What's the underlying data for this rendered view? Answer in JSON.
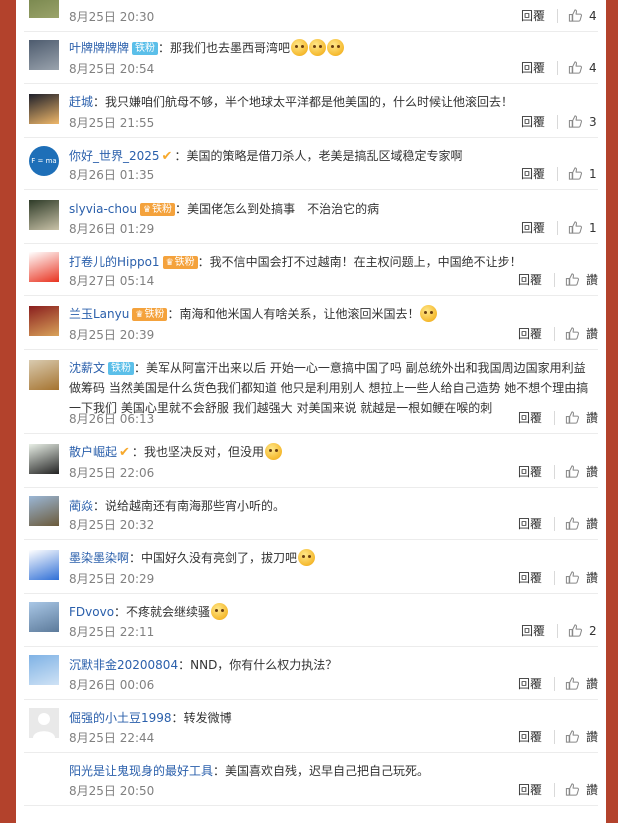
{
  "labels": {
    "reply": "回覆",
    "like_zero": "讚"
  },
  "comments": [
    {
      "user": "",
      "badge": "",
      "badge_type": "",
      "verified": false,
      "text": "",
      "emojis": 0,
      "date": "8月25日 20:30",
      "likes": "4",
      "avatar": [
        "#6f7f46",
        "#9aa36a"
      ]
    },
    {
      "user": "叶牌牌牌牌",
      "badge": "铁粉",
      "badge_type": "blue",
      "verified": false,
      "text": "那我们也去墨西哥湾吧",
      "emojis": 3,
      "date": "8月25日 20:54",
      "likes": "4",
      "avatar": [
        "#4d5b6e",
        "#9aa3ad"
      ]
    },
    {
      "user": "赶城",
      "badge": "",
      "badge_type": "",
      "verified": false,
      "text": "我只嫌咱们航母不够，半个地球太平洋都是他美国的，什么时候让他滚回去！",
      "emojis": 0,
      "date": "8月25日 21:55",
      "likes": "3",
      "avatar": [
        "#1d1f2a",
        "#f0b86a"
      ]
    },
    {
      "user": "你好_世界_2025",
      "badge": "",
      "badge_type": "",
      "verified": true,
      "text": "美国的策略是借刀杀人，老美是搞乱区域稳定专家啊",
      "emojis": 0,
      "date": "8月26日 01:35",
      "likes": "1",
      "avatar": [
        "#1e6fb8",
        "#1e6fb8"
      ],
      "avatar_text": "F = ma"
    },
    {
      "user": "slyvia-chou",
      "badge": "铁粉",
      "badge_type": "gold",
      "verified": false,
      "text": "美国佬怎么到处搞事　不治治它的病",
      "emojis": 0,
      "date": "8月26日 01:29",
      "likes": "1",
      "avatar": [
        "#2e3b28",
        "#c9c2a8"
      ]
    },
    {
      "user": "打卷儿的Hippo1",
      "badge": "铁粉",
      "badge_type": "gold",
      "verified": false,
      "text": "我不信中国会打不过越南！在主权问题上，中国绝不让步！",
      "emojis": 0,
      "date": "8月27日 05:14",
      "likes": "",
      "avatar": [
        "#ffffff",
        "#e8321f"
      ]
    },
    {
      "user": "兰玉Lanyu",
      "badge": "铁粉",
      "badge_type": "gold",
      "verified": false,
      "text": "南海和他米国人有啥关系，让他滚回米国去！",
      "emojis": 1,
      "date": "8月25日 20:39",
      "likes": "",
      "avatar": [
        "#8a1e1e",
        "#d9a35a"
      ]
    },
    {
      "user": "沈薪文",
      "badge": "铁粉",
      "badge_type": "blue",
      "verified": false,
      "text": "美军从阿富汗出来以后 开始一心一意搞中国了吗 副总统外出和我国周边国家用利益做筹码 当然美国是什么货色我们都知道 他只是利用别人 想拉上一些人给自己造势 她不想个理由搞一下我们 美国心里就不会舒服 我们越强大 对美国来说 就越是一根如鲠在喉的刺",
      "emojis": 0,
      "date": "8月26日 06:13",
      "likes": "",
      "avatar": [
        "#d9cbb0",
        "#a5732f"
      ]
    },
    {
      "user": "散户崛起",
      "badge": "",
      "badge_type": "",
      "verified": true,
      "text": "我也坚决反对，但没用",
      "emojis": 1,
      "date": "8月25日 22:06",
      "likes": "",
      "avatar": [
        "#e8efe6",
        "#222222"
      ]
    },
    {
      "user": "蔺焱",
      "badge": "",
      "badge_type": "",
      "verified": false,
      "text": "说给越南还有南海那些宵小听的。",
      "emojis": 0,
      "date": "8月25日 20:32",
      "likes": "",
      "avatar": [
        "#9bb7d6",
        "#6b5a3a"
      ]
    },
    {
      "user": "墨染墨染啊",
      "badge": "",
      "badge_type": "",
      "verified": false,
      "text": "中国好久没有亮剑了，拔刀吧",
      "emojis": 1,
      "date": "8月25日 20:29",
      "likes": "",
      "avatar": [
        "#ffffff",
        "#2f6fd6"
      ]
    },
    {
      "user": "FDvovo",
      "badge": "",
      "badge_type": "",
      "verified": false,
      "text": "不疼就会继续骚",
      "emojis": 1,
      "date": "8月25日 22:11",
      "likes": "2",
      "avatar": [
        "#a9c7e6",
        "#5c7a9a"
      ]
    },
    {
      "user": "沉默非金20200804",
      "badge": "",
      "badge_type": "",
      "verified": false,
      "text": "NND，你有什么权力执法？",
      "emojis": 0,
      "date": "8月26日 00:06",
      "likes": "",
      "avatar": [
        "#7fb2e5",
        "#cfe2f5"
      ]
    },
    {
      "user": "倔强的小土豆1998",
      "badge": "",
      "badge_type": "",
      "verified": false,
      "text": "转发微博",
      "emojis": 0,
      "date": "8月25日 22:44",
      "likes": "",
      "avatar": [
        "#e6e6e6",
        "#ffffff"
      ]
    },
    {
      "user": "阳光是让鬼现身的最好工具",
      "badge": "",
      "badge_type": "",
      "verified": false,
      "text": "美国喜欢自残，迟早自己把自己玩死。",
      "emojis": 0,
      "date": "8月25日 20:50",
      "likes": "",
      "avatar": [
        "#ffffff",
        "#ffffff"
      ]
    }
  ]
}
